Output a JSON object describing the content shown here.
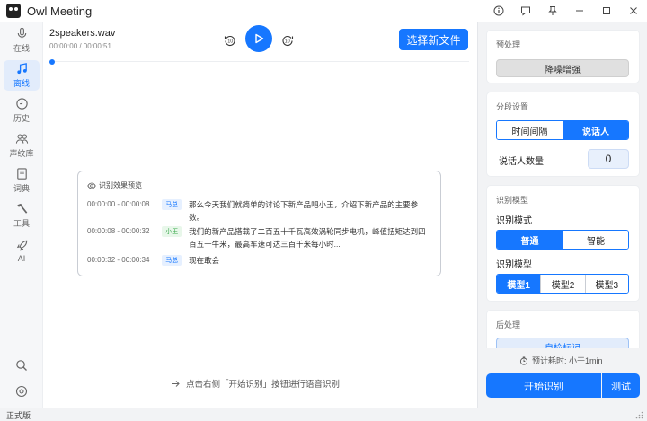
{
  "app": {
    "title": "Owl Meeting"
  },
  "sidebar": {
    "items": [
      {
        "label": "在线",
        "icon": "microphone-icon"
      },
      {
        "label": "离线",
        "icon": "music-note-icon"
      },
      {
        "label": "历史",
        "icon": "clock-icon"
      },
      {
        "label": "声纹库",
        "icon": "users-icon"
      },
      {
        "label": "词典",
        "icon": "book-icon"
      },
      {
        "label": "工具",
        "icon": "hammer-icon"
      },
      {
        "label": "AI",
        "icon": "rocket-icon"
      }
    ],
    "active": "离线"
  },
  "player": {
    "file_name": "2speakers.wav",
    "time": "00:00:00 / 00:00:51",
    "rewind_label": "10",
    "forward_label": "10",
    "select_file_label": "选择新文件",
    "progress": 0
  },
  "preview": {
    "title": "识别效果预览",
    "segments": [
      {
        "time": "00:00:00 - 00:00:08",
        "speaker": "马总",
        "text": "那么今天我们就简单的讨论下新产品吧小王，介绍下新产品的主要参数。"
      },
      {
        "time": "00:00:08 - 00:00:32",
        "speaker": "小王",
        "text": "我们的新产品搭载了二百五十千瓦高效涡轮同步电机，峰值扭矩达到四百五十牛米，最高车速可达三百千米每小时..."
      },
      {
        "time": "00:00:32 - 00:00:34",
        "speaker": "马总",
        "text": "现在敢会"
      }
    ]
  },
  "hint": {
    "text": "点击右侧「开始识别」按钮进行语音识别"
  },
  "panel": {
    "preprocess": {
      "title": "预处理",
      "denoise_label": "降噪增强"
    },
    "segmentation": {
      "title": "分段设置",
      "options": [
        "时间间隔",
        "说话人"
      ],
      "selected": "说话人",
      "speaker_count_label": "说话人数量",
      "speaker_count": "0"
    },
    "recognition": {
      "title": "识别模型",
      "mode_label": "识别模式",
      "modes": [
        "普通",
        "智能"
      ],
      "selected_mode": "普通",
      "model_label": "识别模型",
      "models": [
        "模型1",
        "模型2",
        "模型3"
      ],
      "selected_model": "模型1"
    },
    "postprocess": {
      "title": "后处理",
      "option_label": "自检标记"
    },
    "estimate": "预计耗时: 小于1min",
    "start_label": "开始识别",
    "test_label": "测试"
  },
  "status": {
    "edition": "正式版"
  },
  "colors": {
    "accent": "#1677ff"
  }
}
